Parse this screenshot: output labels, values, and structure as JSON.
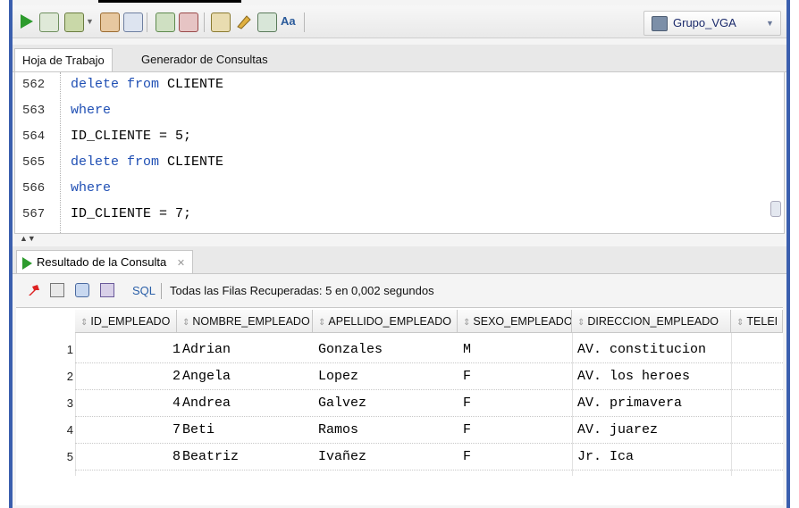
{
  "toolbar": {
    "connection_label": "Grupo_VGA",
    "icons": [
      "run-icon",
      "run-script-icon",
      "commit-icon",
      "rollback-icon",
      "dropdown-arrow-icon",
      "autotrace-icon",
      "explain-plan-icon",
      "sql-tuning-icon",
      "monitor-icon",
      "unshared-sql-icon",
      "eraser-icon",
      "history-icon",
      "format-icon"
    ]
  },
  "editor_tabs": [
    "Hoja de Trabajo",
    "Generador de Consultas"
  ],
  "editor": {
    "lines": [
      {
        "num": "562",
        "tokens": [
          [
            "kw",
            "delete from"
          ],
          [
            "id",
            " CLIENTE"
          ]
        ]
      },
      {
        "num": "563",
        "tokens": [
          [
            "kw",
            "where"
          ]
        ]
      },
      {
        "num": "564",
        "tokens": [
          [
            "id",
            "ID_CLIENTE = 5;"
          ]
        ]
      },
      {
        "num": "565",
        "tokens": [
          [
            "kw",
            "delete from"
          ],
          [
            "id",
            " CLIENTE"
          ]
        ]
      },
      {
        "num": "566",
        "tokens": [
          [
            "kw",
            "where"
          ]
        ]
      },
      {
        "num": "567",
        "tokens": [
          [
            "id",
            "ID_CLIENTE = 7;"
          ]
        ]
      }
    ]
  },
  "results": {
    "tab_label": "Resultado de la Consulta",
    "sql_label": "SQL",
    "status": "Todas las Filas Recuperadas: 5 en 0,002 segundos",
    "columns": [
      "ID_EMPLEADO",
      "NOMBRE_EMPLEADO",
      "APELLIDO_EMPLEADO",
      "SEXO_EMPLEADO",
      "DIRECCION_EMPLEADO",
      "TELEI"
    ],
    "rows": [
      {
        "n": "1",
        "id": "1",
        "nombre": "Adrian",
        "apellido": "Gonzales",
        "sexo": "M",
        "direccion": "AV. constitucion"
      },
      {
        "n": "2",
        "id": "2",
        "nombre": "Angela",
        "apellido": "Lopez",
        "sexo": "F",
        "direccion": "AV. los heroes"
      },
      {
        "n": "3",
        "id": "4",
        "nombre": "Andrea",
        "apellido": "Galvez",
        "sexo": "F",
        "direccion": "AV. primavera"
      },
      {
        "n": "4",
        "id": "7",
        "nombre": "Beti",
        "apellido": "Ramos",
        "sexo": "F",
        "direccion": "AV. juarez"
      },
      {
        "n": "5",
        "id": "8",
        "nombre": "Beatriz",
        "apellido": "Ivañez",
        "sexo": "F",
        "direccion": "Jr. Ica"
      }
    ]
  },
  "colors": {
    "accent": "#3b5fae",
    "keyword": "#1f4fb4",
    "run_green": "#2d9b2d"
  }
}
